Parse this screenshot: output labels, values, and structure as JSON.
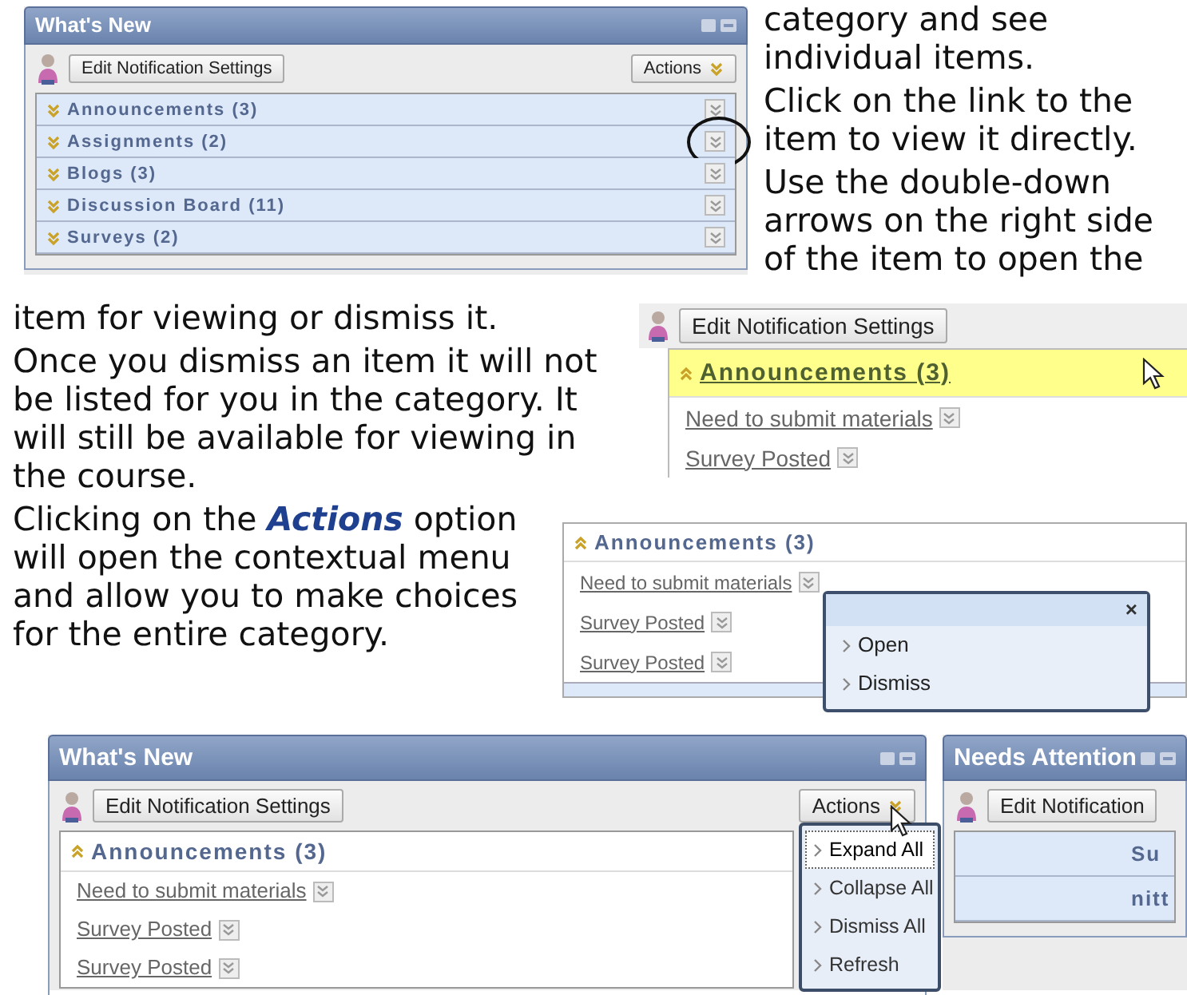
{
  "section_1": {
    "screenshot": {
      "title": "What's New",
      "edit_button": "Edit Notification Settings",
      "actions_button": "Actions",
      "categories": [
        {
          "label": "Announcements (3)",
          "expanded": false,
          "annotated": false
        },
        {
          "label": "Assignments (2)",
          "expanded": false,
          "annotated": true
        },
        {
          "label": "Blogs (3)",
          "expanded": false,
          "annotated": false
        },
        {
          "label": "Discussion Board (11)",
          "expanded": false,
          "annotated": false
        },
        {
          "label": "Surveys (2)",
          "expanded": false,
          "annotated": false
        }
      ]
    },
    "paragraphs": [
      "category and see individual items.",
      "Click on the link to the item to view it directly.",
      "Use the double-down arrows on the right side of the item to open the"
    ]
  },
  "section_2": {
    "paragraphs": [
      "item for viewing or dismiss it.",
      "Once you dismiss an item it will not be listed for you in the category. It will still be available for viewing in the course.",
      "Clicking on the **Actions** option will open the contextual menu and allow you to make choices for the entire category."
    ],
    "screenshots": [
      {
        "edit_button": "Edit Notification Settings",
        "pointer": true,
        "categories": [
          {
            "label": "Announcements (3)",
            "expanded": true,
            "highlighted": true,
            "items": [
              "Need to submit materials",
              "Survey Posted"
            ]
          }
        ]
      },
      {
        "categories": [
          {
            "label": "Announcements (3)",
            "expanded": true,
            "highlighted": false,
            "items": [
              "Need to submit materials",
              "Survey Posted",
              "Survey Posted"
            ]
          }
        ],
        "popup": {
          "close": "×",
          "options": [
            "Open",
            "Dismiss"
          ]
        }
      }
    ]
  },
  "section_3": {
    "screenshots": [
      {
        "title": "What's New",
        "edit_button": "Edit Notification Settings",
        "actions_button": "Actions",
        "pointer": true,
        "categories": [
          {
            "label": "Announcements (3)",
            "expanded": true,
            "highlighted": false,
            "items": [
              "Need to submit materials",
              "Survey Posted",
              "Survey Posted"
            ]
          }
        ],
        "actions_menu": [
          {
            "label": "Expand All",
            "selected": true
          },
          {
            "label": "Collapse All",
            "selected": false
          },
          {
            "label": "Dismiss All",
            "selected": false
          },
          {
            "label": "Refresh",
            "selected": false
          }
        ]
      },
      {
        "title": "Needs Attention",
        "edit_button": "Edit Notification",
        "partial_rows": [
          "Su",
          "nitt"
        ]
      }
    ]
  }
}
